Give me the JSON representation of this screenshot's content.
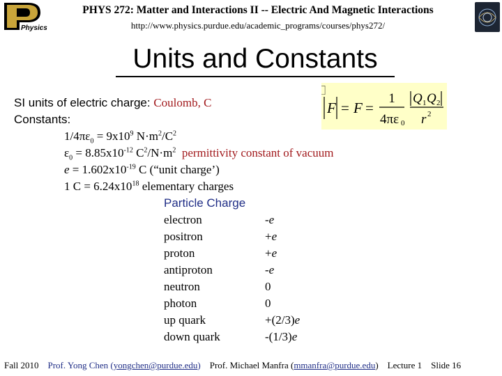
{
  "header": {
    "logo_text": "Physics",
    "course_title": "PHYS 272: Matter and Interactions II -- Electric And Magnetic Interactions",
    "course_url": "http://www.physics.purdue.edu/academic_programs/courses/phys272/"
  },
  "slide_title": "Units and Constants",
  "charge_units": {
    "label": "SI units of electric charge",
    "colon": ": ",
    "value": "Coulomb, C"
  },
  "constants": {
    "label": "Constants",
    "colon": ":",
    "line1": {
      "lhs": "1/4πε",
      "sub": "0",
      "eq": " = 9x10",
      "exp": "9",
      "unit": " N·m",
      "unit_exp": "2",
      "unit_tail": "/C",
      "unit_tail_exp": "2"
    },
    "line2": {
      "sym": "ε",
      "sub": "0",
      "eq": " = 8.85x10",
      "exp": "-12",
      "unit": " C",
      "unit_exp": "2",
      "unit_tail": "/N·m",
      "unit_tail_exp": "2",
      "desc": "  permittivity constant of vacuum"
    },
    "line3": {
      "sym": "e",
      "eq": " = 1.602x10",
      "exp": "-19",
      "tail": " C (“unit charge’)"
    },
    "line4": {
      "lhs": "1 C = 6.24x10",
      "exp": "18",
      "tail": " elementary charges"
    }
  },
  "formula": {
    "numerator_one": "1",
    "denominator": "4πε",
    "denominator_sub": "0",
    "q1": "Q",
    "q1_sub": "1",
    "q2": "Q",
    "q2_sub": "2",
    "r": "r",
    "r_exp": "2",
    "lhs_f": "F",
    "mid_f": "F",
    "box_glyph": "⃞"
  },
  "particle_table": {
    "header": "Particle Charge",
    "rows": [
      {
        "name": "electron",
        "charge": "-e"
      },
      {
        "name": "positron",
        "charge": "+e"
      },
      {
        "name": "proton",
        "charge": "+e"
      },
      {
        "name": "antiproton",
        "charge": "-e"
      },
      {
        "name": "neutron",
        "charge": "0"
      },
      {
        "name": "photon",
        "charge": "0"
      },
      {
        "name": "up quark",
        "charge": "+(2/3)e"
      },
      {
        "name": "down quark",
        "charge": "-(1/3)e"
      }
    ]
  },
  "footer": {
    "term": "Fall 2010",
    "prof1_prefix": "Prof. Yong Chen (",
    "prof1_email": "yongchen@purdue.edu",
    "prof1_suffix": ")",
    "prof2_prefix": "Prof. Michael Manfra (",
    "prof2_email": "mmanfra@purdue.edu",
    "prof2_suffix": ")",
    "lecture": "Lecture 1",
    "slide": "Slide 16"
  },
  "colors": {
    "accent_maroon": "#a1191c",
    "accent_blue": "#1f2d86",
    "formula_bg": "#ffffc8",
    "logo_gold": "#c9a53a"
  }
}
